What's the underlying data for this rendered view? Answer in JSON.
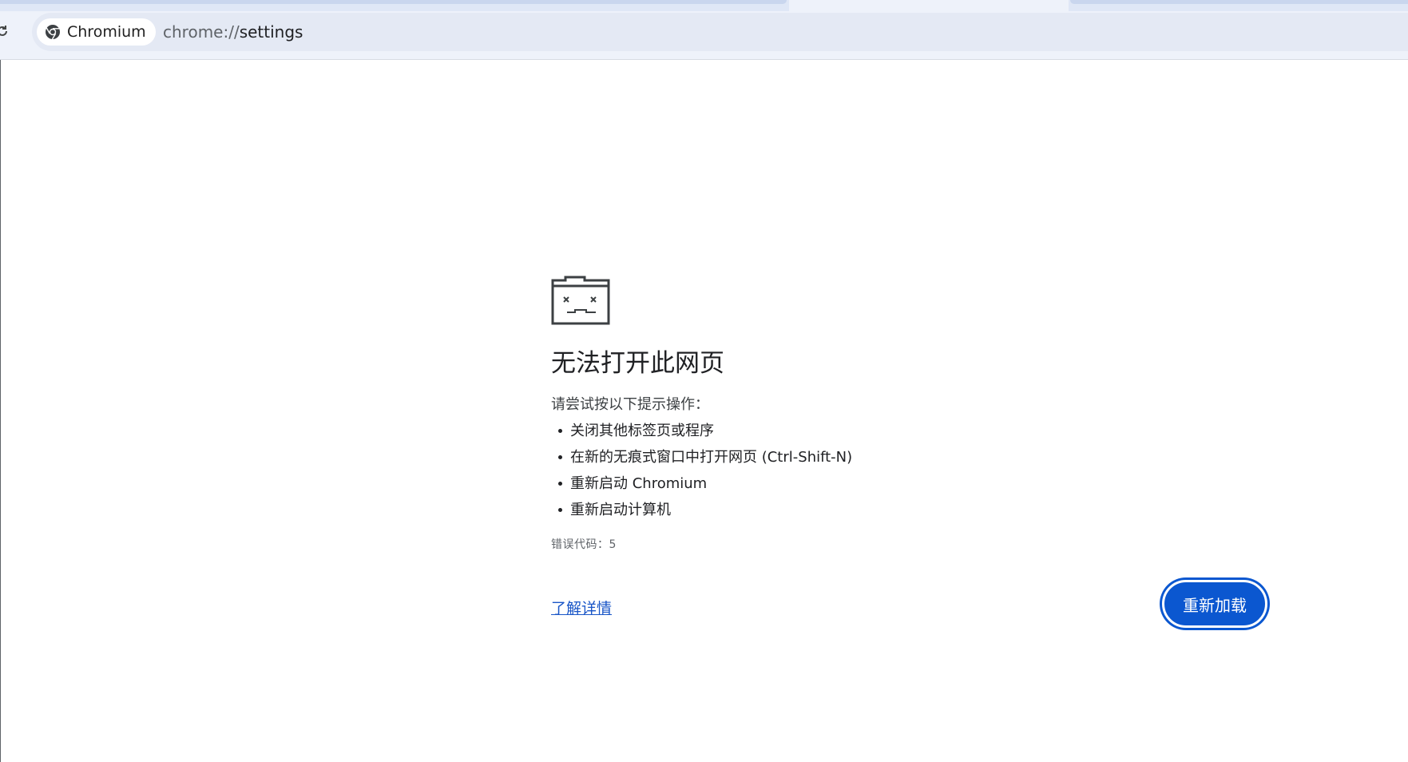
{
  "browser": {
    "site_chip_label": "Chromium",
    "url_scheme": "chrome://",
    "url_path": "settings"
  },
  "error_page": {
    "title": "无法打开此网页",
    "suggest_header": "请尝试按以下提示操作：",
    "suggestions": [
      "关闭其他标签页或程序",
      "在新的无痕式窗口中打开网页 (Ctrl-Shift-N)",
      "重新启动 Chromium",
      "重新启动计算机"
    ],
    "error_code": "错误代码：5",
    "learn_more": "了解详情",
    "reload_button": "重新加载"
  },
  "colors": {
    "accent": "#0b57d0",
    "link": "#1a56c7",
    "toolbar": "#eef2fa"
  },
  "icons": {
    "reload": "reload-icon",
    "chromium": "chromium-logo-icon",
    "sad_page": "sad-page-icon"
  }
}
